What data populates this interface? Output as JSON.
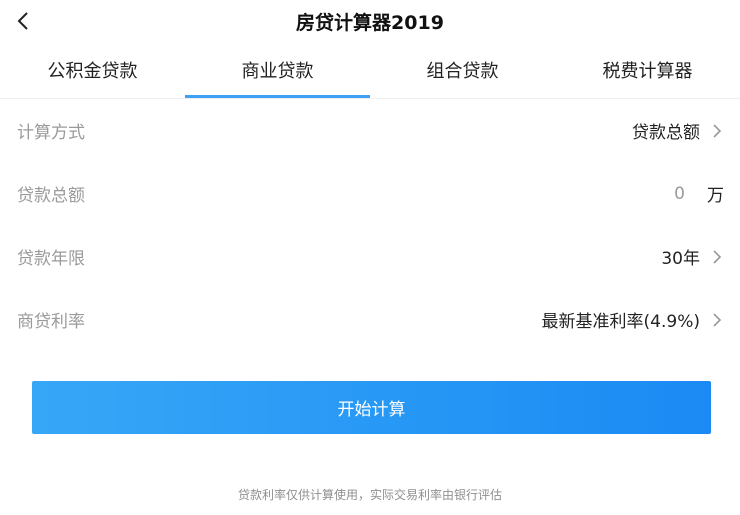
{
  "header": {
    "title": "房贷计算器2019"
  },
  "tabs": [
    {
      "label": "公积金贷款",
      "active": false
    },
    {
      "label": "商业贷款",
      "active": true
    },
    {
      "label": "组合贷款",
      "active": false
    },
    {
      "label": "税费计算器",
      "active": false
    }
  ],
  "form": {
    "method": {
      "label": "计算方式",
      "value": "贷款总额"
    },
    "amount": {
      "label": "贷款总额",
      "value": "0",
      "unit": "万"
    },
    "term": {
      "label": "贷款年限",
      "value": "30年"
    },
    "rate": {
      "label": "商贷利率",
      "value": "最新基准利率(4.9%)"
    }
  },
  "calc_button": {
    "label": "开始计算"
  },
  "disclaimer": "贷款利率仅供计算使用，实际交易利率由银行评估",
  "colors": {
    "accent": "#3fa0f6",
    "button_start": "#36a7f7",
    "button_end": "#1b8af4",
    "label_gray": "#9a9a9a"
  }
}
